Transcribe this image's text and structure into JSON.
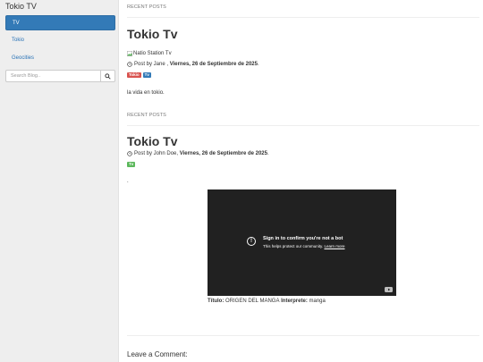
{
  "sidebar": {
    "brand": "Tokio TV",
    "nav": [
      "TV",
      "Tokio",
      "Geocities"
    ],
    "search": {
      "placeholder": "Search Blog.."
    }
  },
  "posts": [
    {
      "section_label": "RECENT POSTS",
      "title": "Tokio Tv",
      "image_alt": "Natio Station Tv",
      "meta": {
        "prefix": "Post by Jane ,",
        "date": "Viernes, 26 de Septiembre de 2025",
        "suffix": "."
      },
      "tags": [
        "Tokio",
        "Tv"
      ],
      "body": "la vida en tokio."
    },
    {
      "section_label": "RECENT POSTS",
      "title": "Tokio Tv",
      "meta": {
        "prefix": "Post by John Doe,",
        "date": "Viernes, 26 de Septiembre de 2025",
        "suffix": "."
      },
      "tags": [
        "Tv"
      ],
      "body": ".",
      "video": {
        "heading": "Sign in to confirm you're not a bot",
        "subtext": "This helps protect our community.",
        "link": "Learn more"
      },
      "caption": {
        "title_label": "Título:",
        "title_value": "ORIGEN DEL MANGA",
        "artist_label": "Interprete:",
        "artist_value": "manga"
      }
    }
  ],
  "comments": {
    "heading": "Leave a Comment:"
  },
  "colors": {
    "active_nav": "#337ab7",
    "link": "#2a73b7",
    "tag_red": "#d9534f",
    "tag_blue": "#337ab7",
    "tag_green": "#5cb85c",
    "video_bg": "#212121"
  }
}
